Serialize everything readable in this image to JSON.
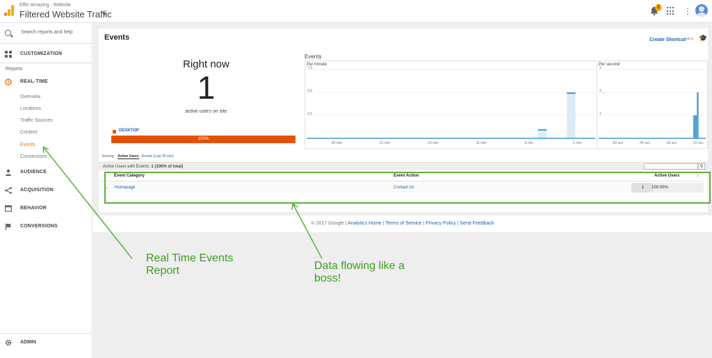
{
  "header": {
    "account_line": "Effin Amazing - Website",
    "property": "Filtered Website Traffic",
    "notification_count": "2"
  },
  "sidebar": {
    "search_placeholder": "Search reports and help",
    "customization": "CUSTOMIZATION",
    "reports_heading": "Reports",
    "realtime": "REAL-TIME",
    "realtime_items": [
      "Overview",
      "Locations",
      "Traffic Sources",
      "Content",
      "Events",
      "Conversions"
    ],
    "active_item": "Events",
    "audience": "AUDIENCE",
    "acquisition": "ACQUISITION",
    "behavior": "BEHAVIOR",
    "conversions": "CONVERSIONS",
    "admin": "ADMIN"
  },
  "page": {
    "title": "Events",
    "create_shortcut": "Create Shortcut",
    "beta": "BETA"
  },
  "right_now": {
    "heading": "Right now",
    "active_users": "1",
    "active_label": "active users on site",
    "device_label": "DESKTOP",
    "device_share": "100%"
  },
  "events_chart": {
    "label": "Events",
    "per_minute_title": "Per minute",
    "per_second_title": "Per second"
  },
  "chart_data": [
    {
      "type": "bar",
      "title": "Per minute",
      "y_ticks": [
        "7.5",
        "5.0",
        "2.5"
      ],
      "ylim": [
        0,
        7.5
      ],
      "x_ticks": [
        "-26 min",
        "-21 min",
        "-16 min",
        "-11 min",
        "-6 min",
        "-1 min"
      ],
      "values": [
        0,
        0,
        0,
        0,
        0,
        0,
        0,
        0,
        0,
        0,
        0,
        0,
        0,
        0,
        0,
        0,
        0,
        0,
        0,
        0,
        0,
        0,
        0,
        0,
        1,
        0,
        0,
        5,
        0,
        0
      ],
      "color": "#3d9bd3"
    },
    {
      "type": "bar",
      "title": "Per second",
      "y_ticks": [
        "3",
        "2",
        "1"
      ],
      "ylim": [
        0,
        3
      ],
      "x_ticks": [
        "-60 sec",
        "-45 sec",
        "-30 sec",
        "-15 sec"
      ],
      "values": [
        0,
        0,
        0,
        0,
        0,
        0,
        0,
        0,
        0,
        0,
        0,
        0,
        0,
        0,
        0,
        0,
        0,
        0,
        0,
        0,
        0,
        0,
        0,
        0,
        0,
        0,
        0,
        0,
        0,
        0,
        0,
        0,
        0,
        0,
        0,
        0,
        0,
        0,
        0,
        0,
        0,
        0,
        0,
        0,
        0,
        0,
        0,
        0,
        0,
        0,
        0,
        0,
        0,
        1,
        1,
        2,
        0,
        0,
        0,
        0
      ],
      "color": "#3d9bd3"
    }
  ],
  "viewing": {
    "label": "Viewing:",
    "tab_active": "Active Users",
    "tab_other": "Events (Last 30 min)"
  },
  "table": {
    "summary_prefix": "Active Users with Events:",
    "summary_value": "1 (100% of total)",
    "headers": [
      "Event Category",
      "Event Action",
      "Active Users"
    ],
    "rows": [
      {
        "index": "1.",
        "category": "Homepage",
        "action": "Contact Us",
        "users": "1",
        "percent": "100.00%"
      }
    ]
  },
  "footer": {
    "copyright": "© 2017 Google",
    "links": [
      "Analytics Home",
      "Terms of Service",
      "Privacy Policy",
      "Send Feedback"
    ]
  },
  "annotations": {
    "left_note_line1": "Real Time Events",
    "left_note_line2": "Report",
    "right_note_line1": "Data flowing like a",
    "right_note_line2": "boss!",
    "color": "#3e9a23"
  }
}
